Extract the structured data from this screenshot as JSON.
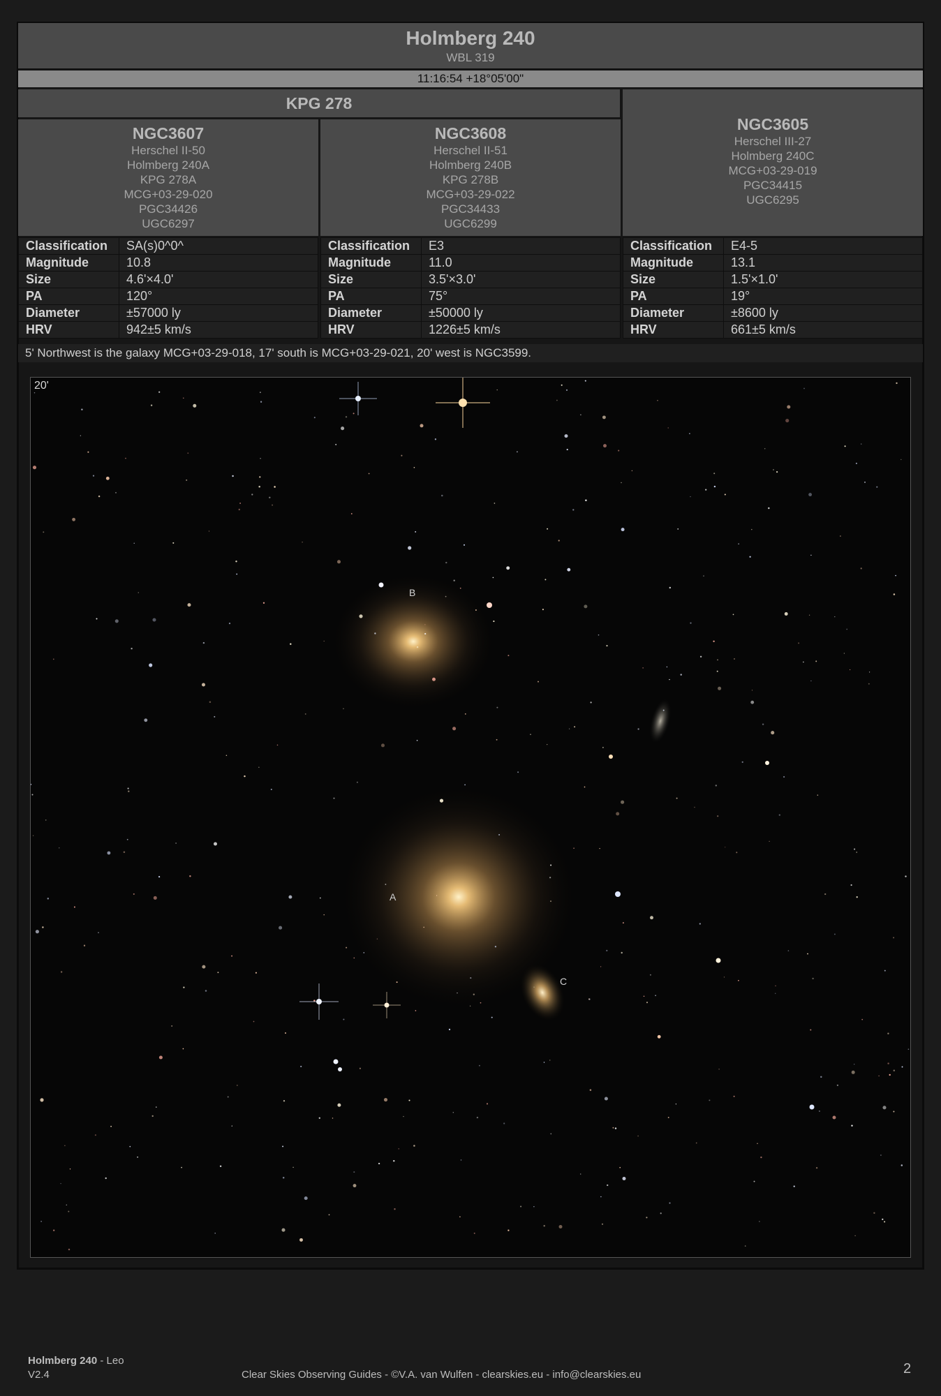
{
  "header": {
    "title": "Holmberg 240",
    "subtitle": "WBL 319",
    "coords": "11:16:54 +18°05'00\""
  },
  "group": {
    "label": "KPG 278"
  },
  "objects": [
    {
      "name": "NGC3607",
      "aliases": [
        "Herschel II-50",
        "Holmberg 240A",
        "KPG 278A",
        "MCG+03-29-020",
        "PGC34426",
        "UGC6297"
      ],
      "props": [
        {
          "k": "Classification",
          "v": "SA(s)0^0^"
        },
        {
          "k": "Magnitude",
          "v": "10.8"
        },
        {
          "k": "Size",
          "v": "4.6'×4.0'"
        },
        {
          "k": "PA",
          "v": "120°"
        },
        {
          "k": "Diameter",
          "v": "±57000 ly"
        },
        {
          "k": "HRV",
          "v": "942±5 km/s"
        }
      ]
    },
    {
      "name": "NGC3608",
      "aliases": [
        "Herschel II-51",
        "Holmberg 240B",
        "KPG 278B",
        "MCG+03-29-022",
        "PGC34433",
        "UGC6299"
      ],
      "props": [
        {
          "k": "Classification",
          "v": "E3"
        },
        {
          "k": "Magnitude",
          "v": "11.0"
        },
        {
          "k": "Size",
          "v": "3.5'×3.0'"
        },
        {
          "k": "PA",
          "v": "75°"
        },
        {
          "k": "Diameter",
          "v": "±50000 ly"
        },
        {
          "k": "HRV",
          "v": "1226±5 km/s"
        }
      ]
    },
    {
      "name": "NGC3605",
      "aliases": [
        "Herschel III-27",
        "Holmberg 240C",
        "MCG+03-29-019",
        "PGC34415",
        "UGC6295"
      ],
      "props": [
        {
          "k": "Classification",
          "v": "E4-5"
        },
        {
          "k": "Magnitude",
          "v": "13.1"
        },
        {
          "k": "Size",
          "v": "1.5'×1.0'"
        },
        {
          "k": "PA",
          "v": "19°"
        },
        {
          "k": "Diameter",
          "v": "±8600 ly"
        },
        {
          "k": "HRV",
          "v": "661±5 km/s"
        }
      ]
    }
  ],
  "note": "5' Northwest is the galaxy MCG+03-29-018, 17' south is MCG+03-29-021, 20' west is NGC3599.",
  "image": {
    "scale_label": "20'",
    "labels": {
      "a": "A",
      "b": "B",
      "c": "C"
    }
  },
  "footer": {
    "object": "Holmberg 240",
    "constellation_sep": " - Leo",
    "version": "V2.4",
    "credits": "Clear Skies Observing Guides - ©V.A. van Wulfen - clearskies.eu - info@clearskies.eu",
    "page": "2"
  }
}
